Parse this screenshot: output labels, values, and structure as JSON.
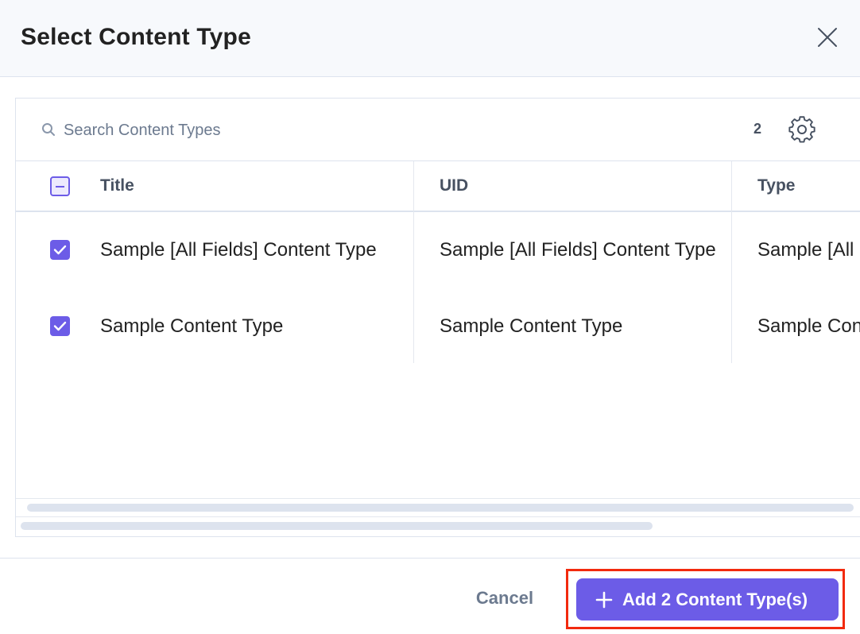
{
  "dialog": {
    "title": "Select Content Type"
  },
  "search": {
    "placeholder": "Search Content Types",
    "value": "",
    "selected_count": "2"
  },
  "table": {
    "columns": [
      "Title",
      "UID",
      "Type"
    ],
    "rows": [
      {
        "checked": true,
        "title": "Sample [All Fields] Content Type",
        "uid": "Sample [All Fields] Content Type",
        "type": "Sample [All Fields] Content Type"
      },
      {
        "checked": true,
        "title": "Sample Content Type",
        "uid": "Sample Content Type",
        "type": "Sample Content Type"
      }
    ]
  },
  "footer": {
    "cancel_label": "Cancel",
    "add_label": "Add 2 Content Type(s)"
  },
  "colors": {
    "accent": "#6c5ce7",
    "highlight_outline": "#f22a0e",
    "header_bg": "#f7f9fc"
  },
  "icons": {
    "close": "close-icon",
    "search": "search-icon",
    "settings": "gear-icon",
    "add": "plus-icon",
    "check": "checkmark-icon"
  }
}
